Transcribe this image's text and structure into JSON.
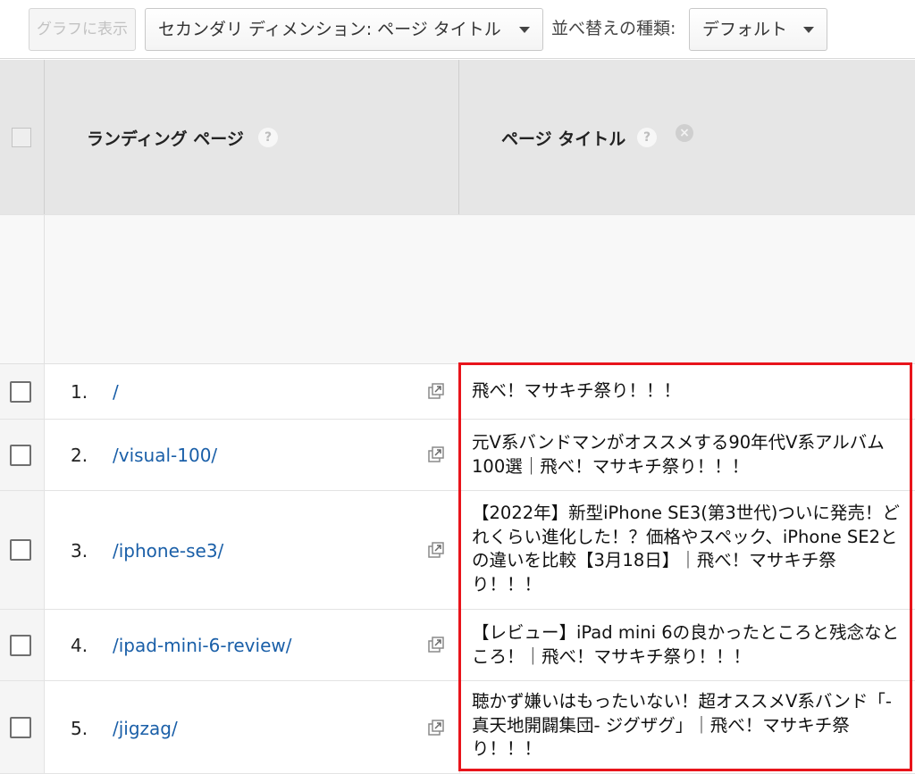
{
  "toolbar": {
    "show_graph_label": "グラフに表示",
    "secondary_dimension_label": "セカンダリ ディメンション: ページ タイトル",
    "sort_type_label": "並べ替えの種類:",
    "sort_value": "デフォルト"
  },
  "columns": {
    "landing_page": "ランディング ページ",
    "page_title": "ページ タイトル",
    "help_glyph": "?",
    "remove_glyph": "×"
  },
  "rows": [
    {
      "rank": "1.",
      "path": "/",
      "title": "飛べ！マサキチ祭り！！！"
    },
    {
      "rank": "2.",
      "path": "/visual-100/",
      "title": "元V系バンドマンがオススメする90年代V系アルバム100選｜飛べ！マサキチ祭り！！！"
    },
    {
      "rank": "3.",
      "path": "/iphone-se3/",
      "title": "【2022年】新型iPhone SE3(第3世代)ついに発売！どれくらい進化した！？価格やスペック、iPhone SE2との違いを比較【3月18日】｜飛べ！マサキチ祭り！！！"
    },
    {
      "rank": "4.",
      "path": "/ipad-mini-6-review/",
      "title": "【レビュー】iPad mini 6の良かったところと残念なところ！｜飛べ！マサキチ祭り！！！"
    },
    {
      "rank": "5.",
      "path": "/jigzag/",
      "title": "聴かず嫌いはもったいない！超オススメV系バンド「-真天地開闢集団- ジグザグ」｜飛べ！マサキチ祭り！！！"
    }
  ],
  "colors": {
    "link": "#1a5fa8",
    "highlight": "#e8141b",
    "header_bg": "#e6e6e6"
  }
}
